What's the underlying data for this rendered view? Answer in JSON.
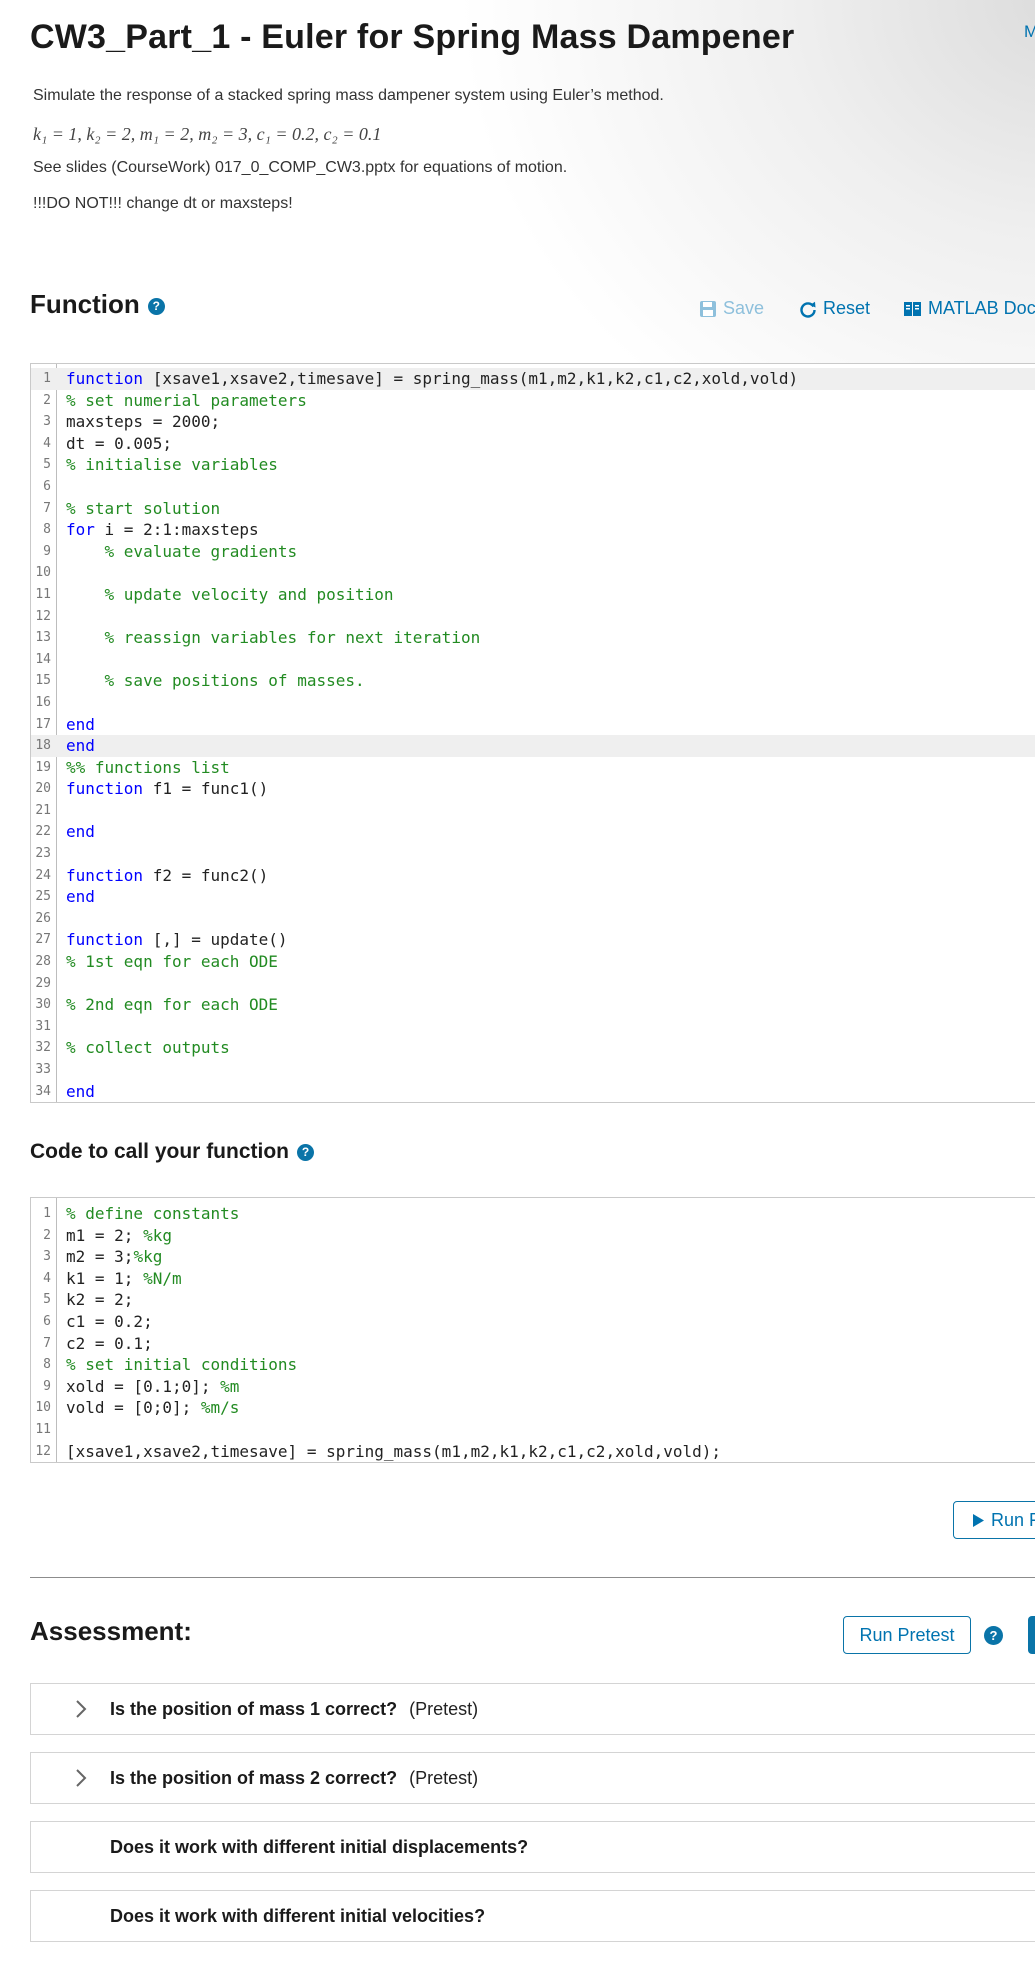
{
  "header": {
    "title": "CW3_Part_1 - Euler for Spring Mass Dampener",
    "top_link": "M"
  },
  "description": {
    "line1": "Simulate the response of a stacked spring mass dampener system using Euler’s method.",
    "math": "k₁ = 1, k₂ = 2, m₁ = 2, m₂ = 3, c₁ = 0.2, c₂ = 0.1",
    "line2": "See slides (CourseWork) 017_0_COMP_CW3.pptx for equations of motion.",
    "line3": "!!!DO NOT!!! change dt or maxsteps!"
  },
  "function_section": {
    "heading": "Function",
    "help_icon": "?",
    "save_label": "Save",
    "reset_label": "Reset",
    "docs_label": "MATLAB Doc"
  },
  "function_code": [
    {
      "n": "1",
      "text": "function [xsave1,xsave2,timesave] = spring_mass(m1,m2,k1,k2,c1,c2,xold,vold)"
    },
    {
      "n": "2",
      "text": "% set numerial parameters"
    },
    {
      "n": "3",
      "text": "maxsteps = 2000;"
    },
    {
      "n": "4",
      "text": "dt = 0.005;"
    },
    {
      "n": "5",
      "text": "% initialise variables"
    },
    {
      "n": "6",
      "text": ""
    },
    {
      "n": "7",
      "text": "% start solution"
    },
    {
      "n": "8",
      "text": "for i = 2:1:maxsteps"
    },
    {
      "n": "9",
      "text": "    % evaluate gradients"
    },
    {
      "n": "10",
      "text": ""
    },
    {
      "n": "11",
      "text": "    % update velocity and position"
    },
    {
      "n": "12",
      "text": ""
    },
    {
      "n": "13",
      "text": "    % reassign variables for next iteration"
    },
    {
      "n": "14",
      "text": ""
    },
    {
      "n": "15",
      "text": "    % save positions of masses."
    },
    {
      "n": "16",
      "text": ""
    },
    {
      "n": "17",
      "text": "end"
    },
    {
      "n": "18",
      "text": "end"
    },
    {
      "n": "19",
      "text": "%% functions list"
    },
    {
      "n": "20",
      "text": "function f1 = func1()"
    },
    {
      "n": "21",
      "text": ""
    },
    {
      "n": "22",
      "text": "end"
    },
    {
      "n": "23",
      "text": ""
    },
    {
      "n": "24",
      "text": "function f2 = func2()"
    },
    {
      "n": "25",
      "text": "end"
    },
    {
      "n": "26",
      "text": ""
    },
    {
      "n": "27",
      "text": "function [,] = update()"
    },
    {
      "n": "28",
      "text": "% 1st eqn for each ODE"
    },
    {
      "n": "29",
      "text": ""
    },
    {
      "n": "30",
      "text": "% 2nd eqn for each ODE"
    },
    {
      "n": "31",
      "text": ""
    },
    {
      "n": "32",
      "text": "% collect outputs"
    },
    {
      "n": "33",
      "text": ""
    },
    {
      "n": "34",
      "text": "end"
    }
  ],
  "call_section": {
    "heading": "Code to call your function",
    "help_icon": "?"
  },
  "call_code": [
    {
      "n": "1",
      "text": "% define constants"
    },
    {
      "n": "2",
      "text": "m1 = 2; %kg"
    },
    {
      "n": "3",
      "text": "m2 = 3;%kg"
    },
    {
      "n": "4",
      "text": "k1 = 1; %N/m"
    },
    {
      "n": "5",
      "text": "k2 = 2;"
    },
    {
      "n": "6",
      "text": "c1 = 0.2;"
    },
    {
      "n": "7",
      "text": "c2 = 0.1;"
    },
    {
      "n": "8",
      "text": "% set initial conditions"
    },
    {
      "n": "9",
      "text": "xold = [0.1;0]; %m"
    },
    {
      "n": "10",
      "text": "vold = [0;0]; %m/s"
    },
    {
      "n": "11",
      "text": ""
    },
    {
      "n": "12",
      "text": "[xsave1,xsave2,timesave] = spring_mass(m1,m2,k1,k2,c1,c2,xold,vold);"
    }
  ],
  "run": {
    "label": "Run F"
  },
  "assessment": {
    "heading": "Assessment:",
    "run_pretest_label": "Run Pretest",
    "help_icon": "?",
    "items": [
      {
        "title": "Is the position of mass 1 correct?",
        "tag": "(Pretest)"
      },
      {
        "title": "Is the position of mass 2 correct?",
        "tag": "(Pretest)"
      },
      {
        "title": "Does it work with different initial displacements?",
        "tag": ""
      },
      {
        "title": "Does it work with different initial velocities?",
        "tag": ""
      }
    ]
  },
  "colors": {
    "accent": "#0073b0",
    "keyword": "#0000ff",
    "comment": "#228b22"
  }
}
